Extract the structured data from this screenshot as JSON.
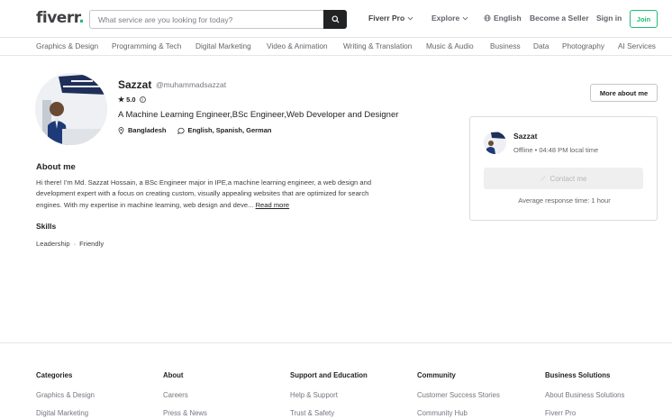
{
  "header": {
    "logo": "fiverr",
    "logo_dot": ".",
    "search_placeholder": "What service are you looking for today?",
    "fiverr_pro": "Fiverr Pro",
    "explore": "Explore",
    "language": "English",
    "become_seller": "Become a Seller",
    "sign_in": "Sign in",
    "join": "Join"
  },
  "categories": [
    "Graphics & Design",
    "Programming & Tech",
    "Digital Marketing",
    "Video & Animation",
    "Writing & Translation",
    "Music & Audio",
    "Business",
    "Data",
    "Photography",
    "AI Services"
  ],
  "profile": {
    "name": "Sazzat",
    "username": "@muhammadsazzat",
    "rating": "5.0",
    "tagline": "A Machine Learning Engineer,BSc Engineer,Web Developer and Designer",
    "country": "Bangladesh",
    "languages": "English, Spanish, German",
    "more_about_me": "More about me",
    "avatar_banner_text": "DEPARTMENT OF INDUSTRIAL & PRODUCTION ENGINEERING"
  },
  "contact_card": {
    "name": "Sazzat",
    "status": "Offline • 04:48 PM local time",
    "contact_button": "Contact me",
    "response_time": "Average response time: 1 hour"
  },
  "about": {
    "heading": "About me",
    "text": "Hi there! I'm Md. Sazzat Hossain, a BSc Engineer major in IPE,a machine learning engineer, a web design and development expert with a focus on creating custom, visually appealing websites that are optimized for search engines. With my expertise in machine learning, web design and deve...",
    "read_more": "Read more"
  },
  "skills": {
    "heading": "Skills",
    "items": [
      "Leadership",
      "Friendly"
    ],
    "separator": "·"
  },
  "footer": {
    "columns": [
      {
        "heading": "Categories",
        "links": [
          "Graphics & Design",
          "Digital Marketing"
        ]
      },
      {
        "heading": "About",
        "links": [
          "Careers",
          "Press & News"
        ]
      },
      {
        "heading": "Support and Education",
        "links": [
          "Help & Support",
          "Trust & Safety"
        ]
      },
      {
        "heading": "Community",
        "links": [
          "Customer Success Stories",
          "Community Hub"
        ]
      },
      {
        "heading": "Business Solutions",
        "links": [
          "About Business Solutions",
          "Fiverr Pro"
        ]
      }
    ]
  },
  "colors": {
    "brand_green": "#1dbf73",
    "text_dark": "#222325",
    "search_button": "#222325"
  }
}
